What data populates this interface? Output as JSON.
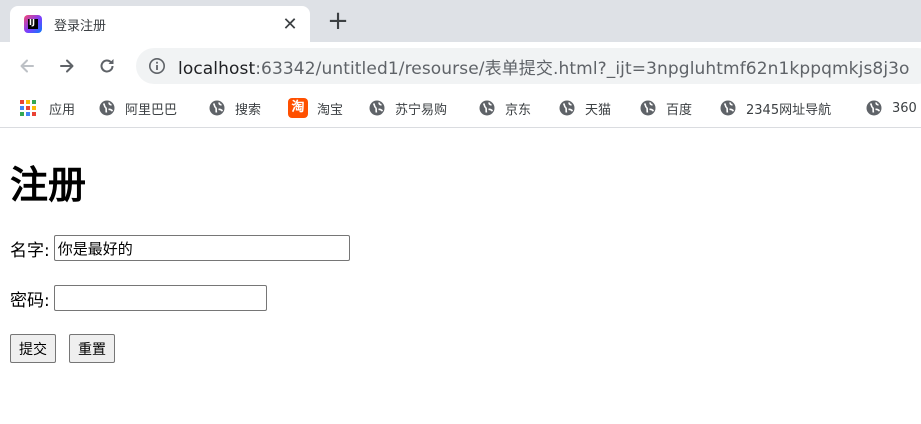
{
  "tab": {
    "title": "登录注册",
    "close_glyph": "✕"
  },
  "newtab_glyph": "+",
  "address": {
    "host": "localhost",
    "rest": ":63342/untitled1/resourse/表单提交.html?_ijt=3npgluhtmf62n1kppqmkjs8j3o"
  },
  "bookmarks": [
    {
      "label": "应用",
      "icon": "apps-icon"
    },
    {
      "label": "阿里巴巴",
      "icon": "globe-icon"
    },
    {
      "label": "搜索",
      "icon": "globe-icon"
    },
    {
      "label": "淘宝",
      "icon": "taobao-icon"
    },
    {
      "label": "苏宁易购",
      "icon": "globe-icon"
    },
    {
      "label": "京东",
      "icon": "globe-icon"
    },
    {
      "label": "天猫",
      "icon": "globe-icon"
    },
    {
      "label": "百度",
      "icon": "globe-icon"
    },
    {
      "label": "2345网址导航",
      "icon": "globe-icon"
    },
    {
      "label": "360",
      "icon": "globe-icon"
    }
  ],
  "form": {
    "heading": "注册",
    "name_label": "名字:",
    "name_value": "你是最好的",
    "password_label": "密码:",
    "password_value": "",
    "submit_label": "提交",
    "reset_label": "重置"
  },
  "colors": {
    "tabstrip_bg": "#dee1e6",
    "omnibox_bg": "#f1f3f4",
    "taobao_orange": "#ff5000",
    "apps_dots": [
      "#ea4335",
      "#fbbc05",
      "#34a853",
      "#4285f4"
    ]
  }
}
